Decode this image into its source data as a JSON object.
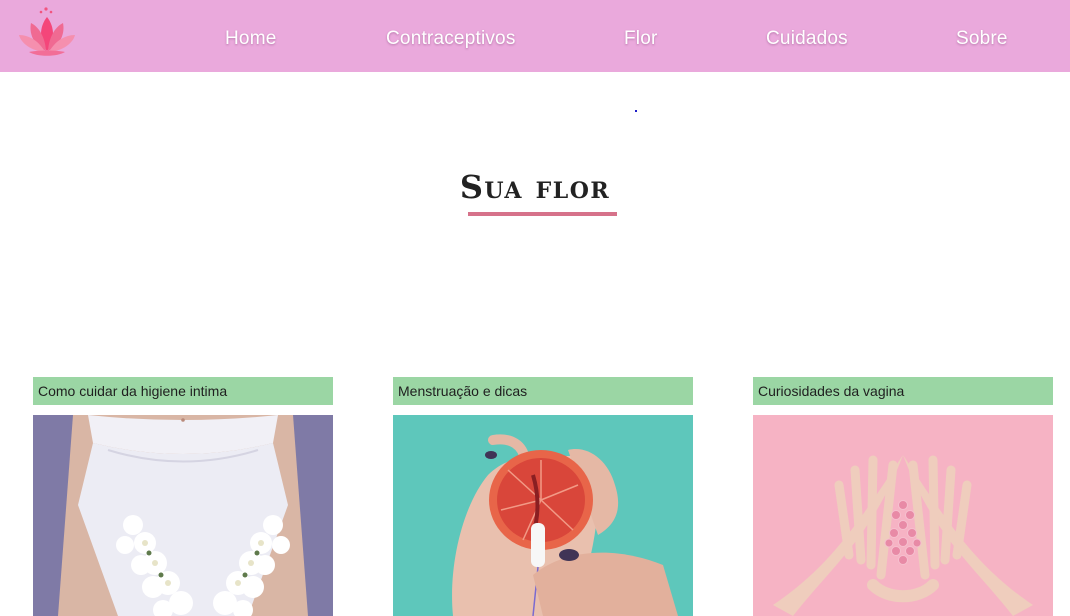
{
  "nav": {
    "items": [
      {
        "label": "Home"
      },
      {
        "label": "Contraceptivos"
      },
      {
        "label": "Flor"
      },
      {
        "label": "Cuidados"
      },
      {
        "label": "Sobre"
      }
    ]
  },
  "main": {
    "title": "Sua flor"
  },
  "cards": [
    {
      "label": "Como cuidar da higiene intima",
      "image": "underwear-with-flowers"
    },
    {
      "label": "Menstruação e dicas",
      "image": "grapefruit-and-tampon"
    },
    {
      "label": "Curiosidades da vagina",
      "image": "hands-with-pink-beads"
    }
  ],
  "colors": {
    "navbar": "#eaa9dc",
    "label_bg": "#9bd6a4",
    "underline": "#d6728a"
  }
}
